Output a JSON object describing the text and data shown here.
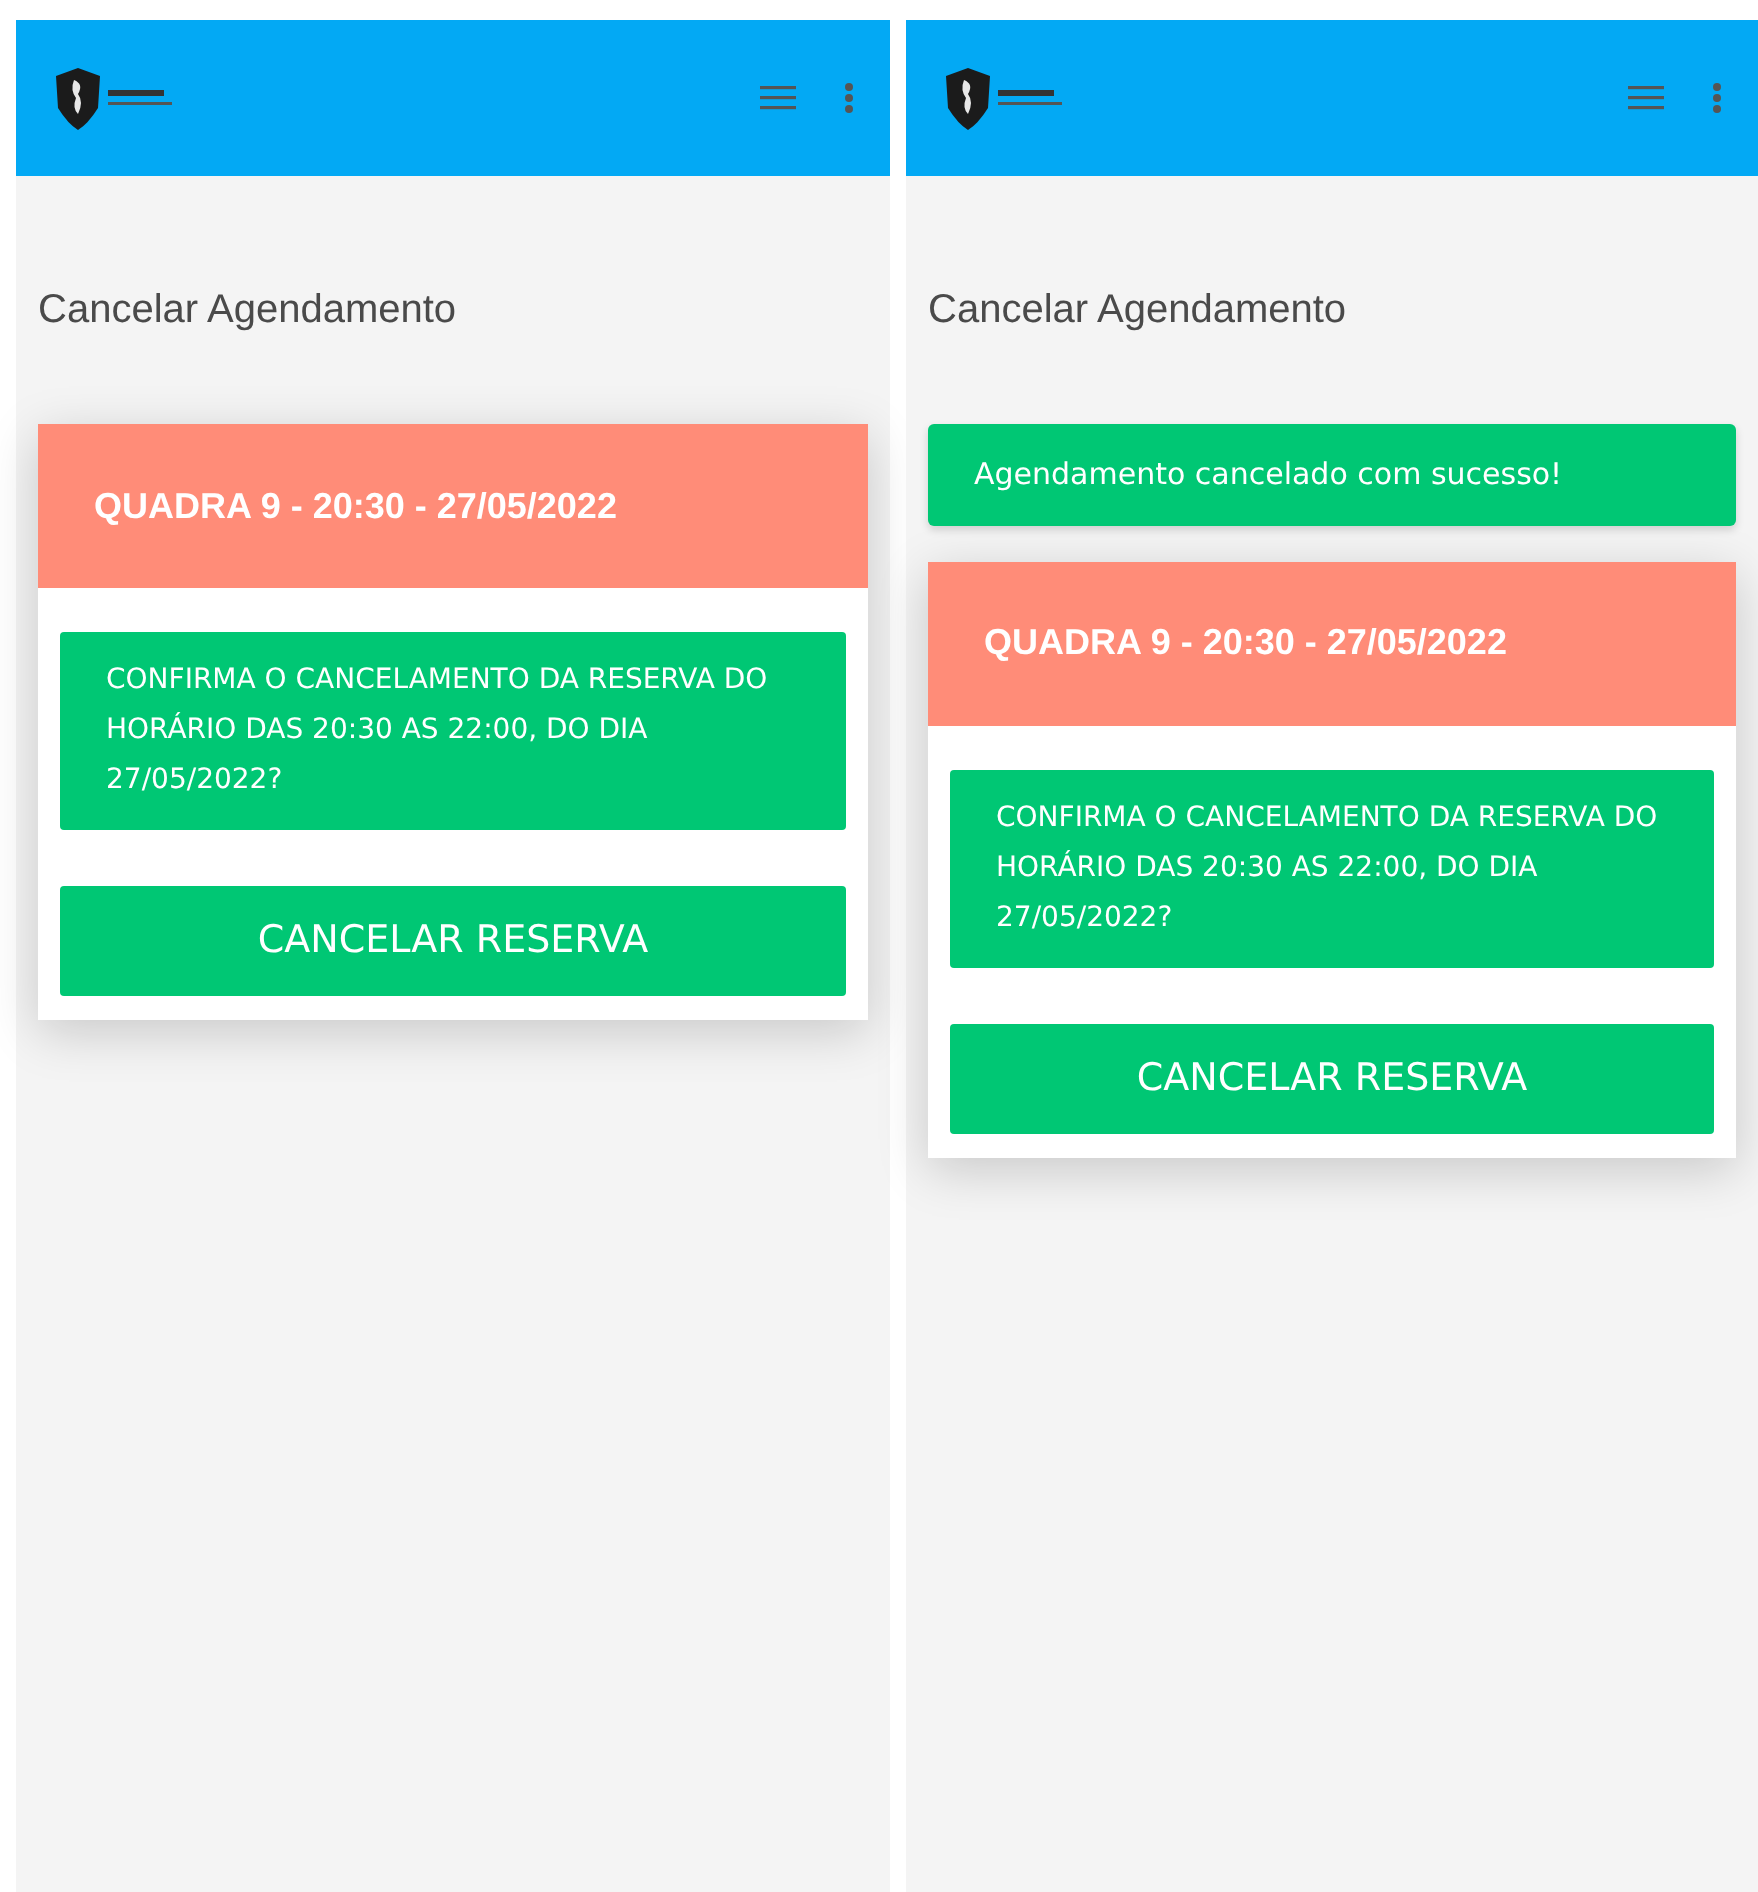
{
  "screens": [
    {
      "page_title": "Cancelar Agendamento",
      "card": {
        "heading": "QUADRA 9 - 20:30 - 27/05/2022",
        "message": "CONFIRMA O CANCELAMENTO DA RESERVA DO HORÁRIO DAS 20:30 AS 22:00, DO DIA 27/05/2022?",
        "button": "CANCELAR RESERVA"
      }
    },
    {
      "page_title": "Cancelar Agendamento",
      "alert": "Agendamento cancelado com sucesso!",
      "card": {
        "heading": "QUADRA 9 - 20:30 - 27/05/2022",
        "message": "CONFIRMA O CANCELAMENTO DA RESERVA DO HORÁRIO DAS 20:30 AS 22:00, DO DIA 27/05/2022?",
        "button": "CANCELAR RESERVA"
      }
    }
  ]
}
